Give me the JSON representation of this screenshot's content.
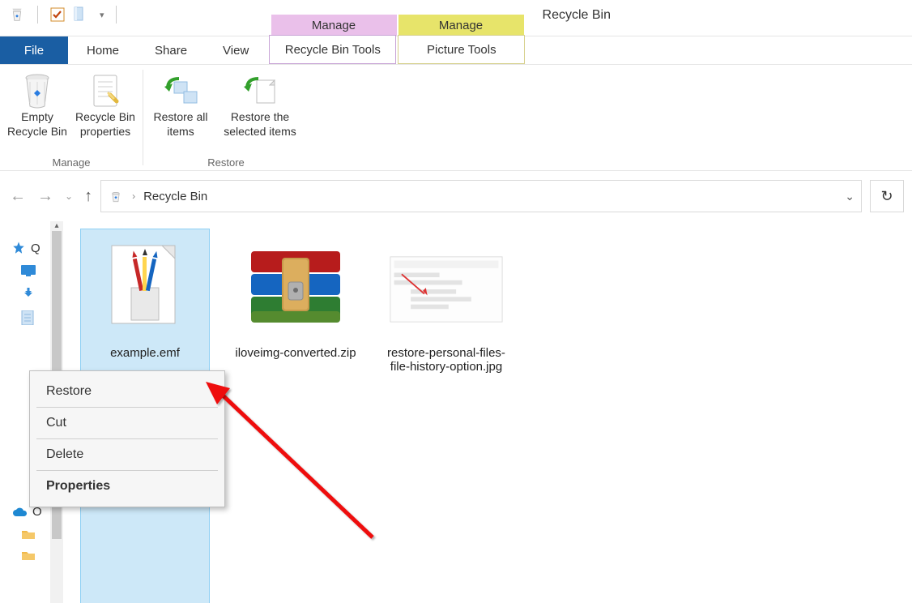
{
  "window_title": "Recycle Bin",
  "contextual_tabs": [
    {
      "label": "Manage",
      "color": "pink"
    },
    {
      "label": "Manage",
      "color": "yellow"
    }
  ],
  "tabs": {
    "file": "File",
    "items": [
      "Home",
      "Share",
      "View"
    ],
    "tool_tabs": [
      "Recycle Bin Tools",
      "Picture Tools"
    ]
  },
  "ribbon": {
    "manage": {
      "label": "Manage",
      "empty": "Empty Recycle Bin",
      "props": "Recycle Bin properties"
    },
    "restore": {
      "label": "Restore",
      "all": "Restore all items",
      "selected": "Restore the selected items"
    }
  },
  "address": {
    "location": "Recycle Bin"
  },
  "sidebar": {
    "quick_label": "Q",
    "onedrive_label": "O"
  },
  "files": [
    {
      "name": "example.emf",
      "selected": true,
      "kind": "emf"
    },
    {
      "name": "iloveimg-converted.zip",
      "selected": false,
      "kind": "zip"
    },
    {
      "name": "restore-personal-files-file-history-option.jpg",
      "selected": false,
      "kind": "image"
    }
  ],
  "context_menu": {
    "restore": "Restore",
    "cut": "Cut",
    "delete": "Delete",
    "properties": "Properties"
  }
}
